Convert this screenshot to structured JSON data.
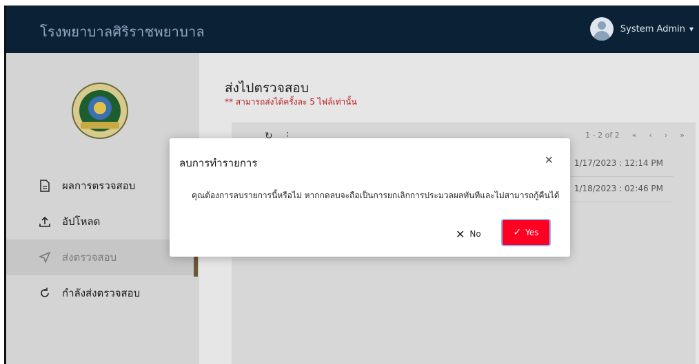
{
  "header": {
    "brand": "โรงพยาบาลศิริราชพยาบาล",
    "user_name": "System Admin",
    "user_chevron_icon": "chevron-down-icon"
  },
  "sidebar": {
    "items": [
      {
        "label": "ผลการตรวจสอบ",
        "icon": "document-icon",
        "active": false
      },
      {
        "label": "อัปโหลด",
        "icon": "upload-icon",
        "active": false
      },
      {
        "label": "ส่งตรวจสอบ",
        "icon": "send-icon",
        "active": true
      },
      {
        "label": "กำลังส่งตรวจสอบ",
        "icon": "refresh-icon",
        "active": false
      }
    ]
  },
  "main": {
    "title": "ส่งไปตรวจสอบ",
    "note": "** สามารถส่งได้ครั้งละ 5 ไฟล์เท่านั้น",
    "pager": {
      "range": "1 - 2 of 2",
      "first": "«",
      "prev": "‹",
      "next": "›",
      "last": "»"
    },
    "rows": [
      {
        "date": "1/17/2023 : 12:14 PM"
      },
      {
        "date": "1/18/2023 : 02:46 PM"
      }
    ]
  },
  "modal": {
    "title": "ลบการทำรายการ",
    "message": "คุณต้องการลบรายการนี้หรือไม่ หากกดลบจะถือเป็นการยกเลิกการประมวลผลทันทีและไม่สามารถกู้คืนได้",
    "no_label": "No",
    "yes_label": "Yes"
  },
  "colors": {
    "header_bg": "#0b2236",
    "brand_text": "#8fa9c3",
    "note_red": "#b81e23",
    "yes_red": "#ff0022",
    "sidebar_accent": "#6e5737"
  }
}
